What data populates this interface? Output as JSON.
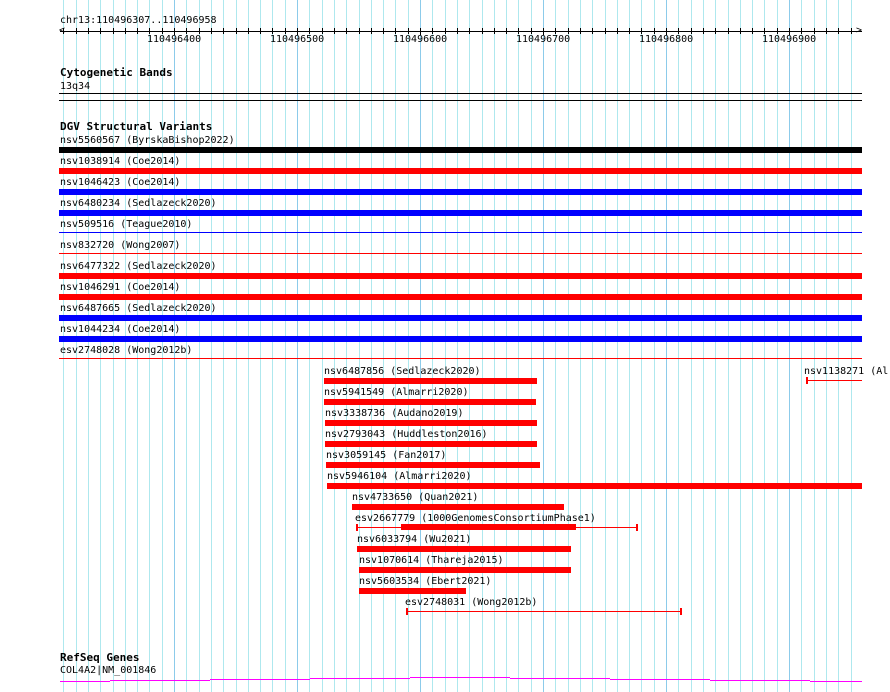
{
  "ruler": {
    "location": "chr13:110496307..110496958",
    "ticks": [
      "110496400",
      "110496500",
      "110496600",
      "110496700",
      "110496800",
      "110496900"
    ]
  },
  "colors": {
    "red": "#ff0000",
    "blue": "#0000ff",
    "black": "#000000",
    "gene": "#ff00ff",
    "grid": "#aee8ee",
    "grid_major": "#8ccbea"
  },
  "tracks": {
    "cytoband": {
      "title": "Cytogenetic Bands",
      "band": "13q34"
    },
    "dgv": {
      "title": "DGV Structural Variants",
      "full_rows": [
        {
          "label": "nsv5560567 (ByrskaBishop2022)",
          "color": "black",
          "style": "thick"
        },
        {
          "label": "nsv1038914 (Coe2014)",
          "color": "red",
          "style": "thick"
        },
        {
          "label": "nsv1046423 (Coe2014)",
          "color": "blue",
          "style": "thick"
        },
        {
          "label": "nsv6480234 (Sedlazeck2020)",
          "color": "blue",
          "style": "thick"
        },
        {
          "label": "nsv509516 (Teague2010)",
          "color": "blue",
          "style": "thin"
        },
        {
          "label": "nsv832720 (Wong2007)",
          "color": "red",
          "style": "thin"
        },
        {
          "label": "nsv6477322 (Sedlazeck2020)",
          "color": "red",
          "style": "thick"
        },
        {
          "label": "nsv1046291 (Coe2014)",
          "color": "red",
          "style": "thick"
        },
        {
          "label": "nsv6487665 (Sedlazeck2020)",
          "color": "blue",
          "style": "thick"
        },
        {
          "label": "nsv1044234 (Coe2014)",
          "color": "blue",
          "style": "thick"
        },
        {
          "label": "esv2748028 (Wong2012b)",
          "color": "red",
          "style": "thin"
        }
      ],
      "features": [
        {
          "label": "nsv6487856 (Sedlazeck2020)",
          "color": "red"
        },
        {
          "label": "nsv1138271 (Al",
          "color": "red"
        },
        {
          "label": "nsv5941549 (Almarri2020)",
          "color": "red"
        },
        {
          "label": "nsv3338736 (Audano2019)",
          "color": "red"
        },
        {
          "label": "nsv2793043 (Huddleston2016)",
          "color": "red"
        },
        {
          "label": "nsv3059145 (Fan2017)",
          "color": "red"
        },
        {
          "label": "nsv5946104 (Almarri2020)",
          "color": "red"
        },
        {
          "label": "nsv4733650 (Quan2021)",
          "color": "red"
        },
        {
          "label": "esv2667779 (1000GenomesConsortiumPhase1)",
          "color": "red"
        },
        {
          "label": "nsv6033794 (Wu2021)",
          "color": "red"
        },
        {
          "label": "nsv1070614 (Thareja2015)",
          "color": "red"
        },
        {
          "label": "nsv5603534 (Ebert2021)",
          "color": "red"
        },
        {
          "label": "esv2748031 (Wong2012b)",
          "color": "red"
        }
      ]
    },
    "refseq": {
      "title": "RefSeq Genes",
      "gene": "COL4A2|NM_001846"
    }
  }
}
